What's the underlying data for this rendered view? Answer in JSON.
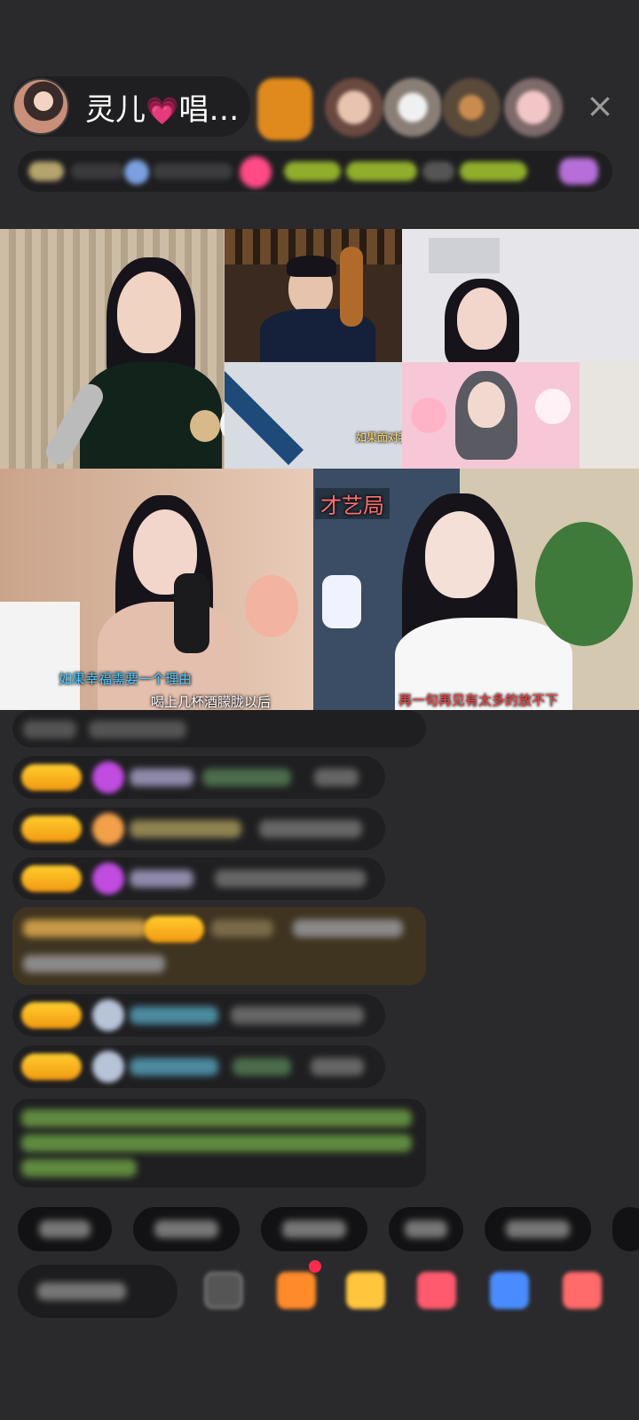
{
  "header": {
    "host_name": "灵儿",
    "host_heart": "💗",
    "host_suffix": "唱…",
    "close_icon": "×"
  },
  "stream_tiles": [
    {
      "caption": ""
    },
    {
      "caption": ""
    },
    {
      "caption": ""
    },
    {
      "caption": "如果面对我"
    },
    {
      "caption_top": "如果幸福需要一个理由",
      "caption_bottom": "喝上几杯酒朦胧以后"
    },
    {
      "label": "才艺局",
      "caption": "再一句再见有太多的放不下"
    }
  ],
  "colors": {
    "background": "#2a2a2c",
    "badge_gold": "#f6b51d",
    "caption_blue": "#4cc7ff",
    "caption_red": "#ff3b3b",
    "notification_dot": "#ff2a4d"
  }
}
